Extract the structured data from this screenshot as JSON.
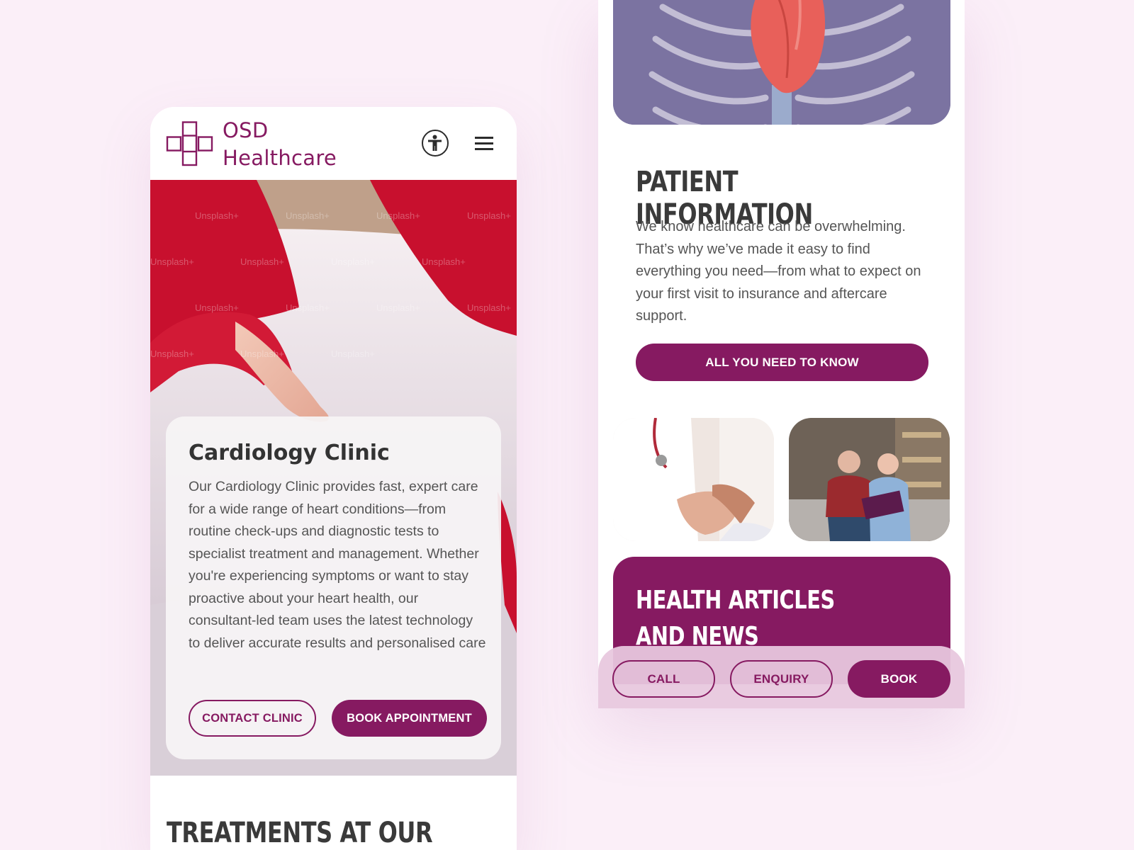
{
  "brand": {
    "line1": "OSD",
    "line2": "Healthcare"
  },
  "header": {
    "accessibility_icon": "accessibility-icon",
    "menu_icon": "hamburger-menu-icon"
  },
  "hero": {
    "watermark": "Unsplash+",
    "card_title": "Cardiology Clinic",
    "card_text": "Our Cardiology Clinic provides fast, expert care for a wide range of heart conditions—from routine check-ups and diagnostic tests to specialist treatment and management. Whether you're experiencing symptoms or want to stay proactive about your heart health, our consultant-led team uses the latest technology to deliver accurate results and personalised care",
    "contact_label": "CONTACT CLINIC",
    "book_label": "BOOK APPOINTMENT"
  },
  "treatments": {
    "title": "TREATMENTS AT OUR CLINIC"
  },
  "patient_info": {
    "title": "PATIENT INFORMATION",
    "text": "We know healthcare can be overwhelming. That’s why we’ve made it easy to find everything you need—from what to expect on your first visit to insurance and aftercare support.",
    "cta_label": "ALL YOU NEED TO KNOW"
  },
  "news": {
    "title": "HEALTH ARTICLES AND NEWS"
  },
  "bottom_bar": {
    "call": "CALL",
    "enquiry": "ENQUIRY",
    "book": "BOOK"
  },
  "colors": {
    "brand": "#861a61",
    "background": "#fbeff8",
    "text": "#555555",
    "heading": "#3a3a3a"
  }
}
